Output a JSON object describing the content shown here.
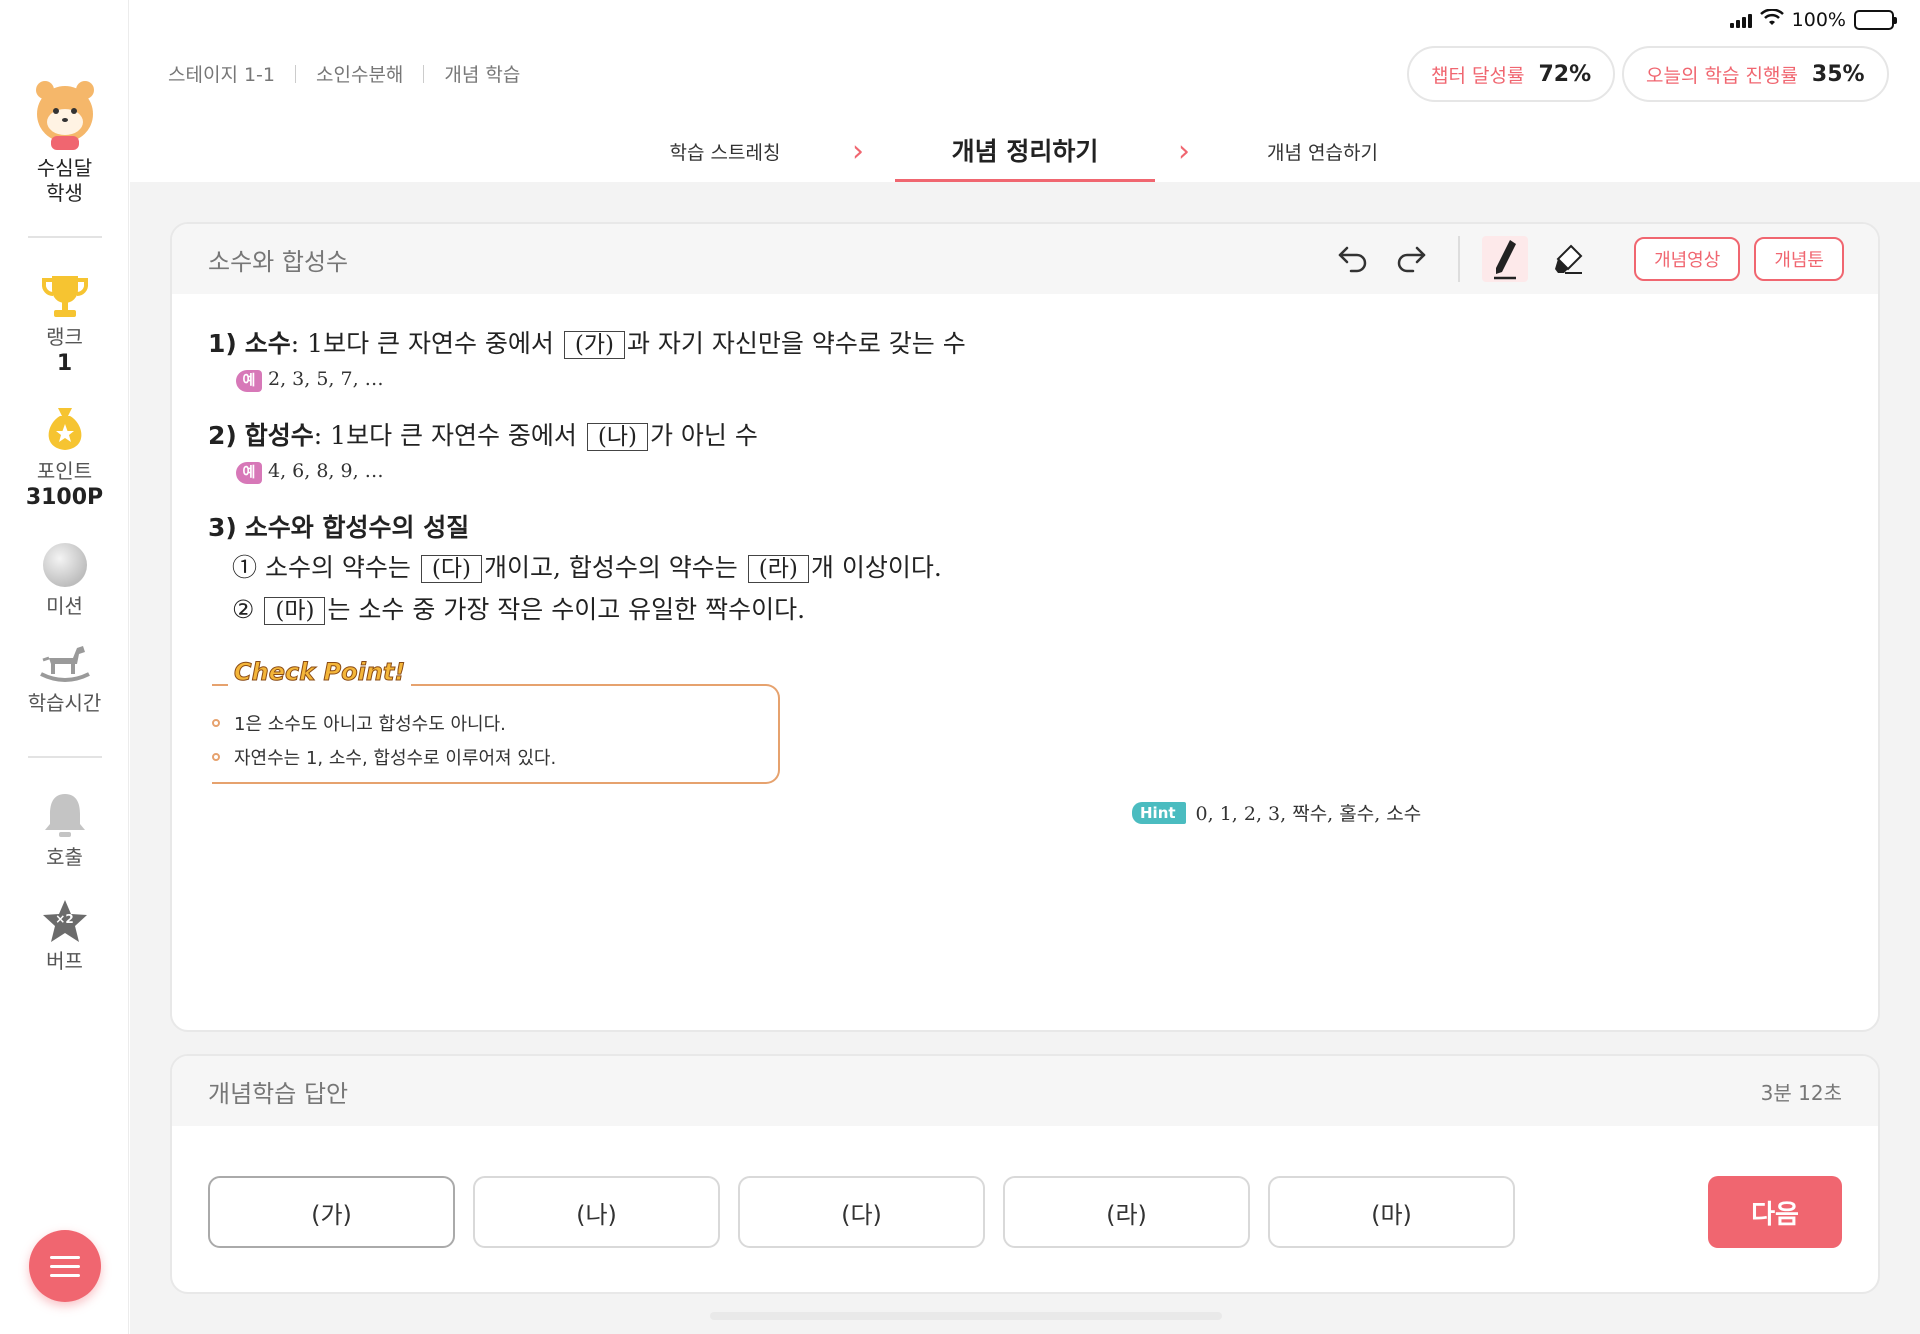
{
  "status_bar": {
    "battery": "100%"
  },
  "sidebar": {
    "profile_name": "수심달",
    "profile_role": "학생",
    "rank_label": "랭크",
    "rank_value": "1",
    "point_label": "포인트",
    "point_value": "3100P",
    "mission_label": "미션",
    "study_time_label": "학습시간",
    "call_label": "호출",
    "buff_label": "버프",
    "buff_badge": "×2"
  },
  "breadcrumb": [
    "스테이지 1-1",
    "소인수분해",
    "개념 학습"
  ],
  "progress": {
    "chapter_label": "챕터 달성률",
    "chapter_value": "72%",
    "today_label": "오늘의 학습 진행률",
    "today_value": "35%"
  },
  "steps": [
    "학습 스트레칭",
    "개념 정리하기",
    "개념 연습하기"
  ],
  "active_step": 1,
  "panel": {
    "title": "소수와 합성수",
    "video_button": "개념영상",
    "toon_button": "개념툰"
  },
  "content": {
    "l1_num": "1)",
    "l1_term": "소수",
    "l1_pre": ": 1보다 큰 자연수 중에서 ",
    "l1_box": "(가)",
    "l1_post": "과 자기 자신만을 약수로 갖는 수",
    "ex_badge": "예",
    "ex1": "2, 3, 5, 7, …",
    "l2_num": "2)",
    "l2_term": "합성수",
    "l2_pre": ": 1보다 큰 자연수 중에서 ",
    "l2_box": "(나)",
    "l2_post": "가 아닌 수",
    "ex2": "4, 6, 8, 9, …",
    "l3_num": "3)",
    "l3_title": "소수와 합성수의 성질",
    "p1_mark": "①",
    "p1_a": " 소수의 약수는 ",
    "p1_box1": "(다)",
    "p1_b": "개이고, 합성수의 약수는 ",
    "p1_box2": "(라)",
    "p1_c": "개 이상이다.",
    "p2_mark": "②",
    "p2_box": "(마)",
    "p2_a": "는 소수 중 가장 작은 수이고 유일한 짝수이다."
  },
  "checkpoint": {
    "title": "Check Point!",
    "items": [
      "1은 소수도 아니고 합성수도 아니다.",
      "자연수는 1, 소수, 합성수로 이루어져 있다."
    ]
  },
  "hint": {
    "badge": "Hint",
    "text": "0, 1, 2, 3, 짝수, 홀수, 소수"
  },
  "answer": {
    "title": "개념학습 답안",
    "timer": "3분 12초",
    "choices": [
      "(가)",
      "(나)",
      "(다)",
      "(라)",
      "(마)"
    ],
    "next_button": "다음"
  },
  "colors": {
    "accent": "#f06670",
    "hint": "#4bbcc0",
    "checkpoint": "#e6a26e"
  }
}
